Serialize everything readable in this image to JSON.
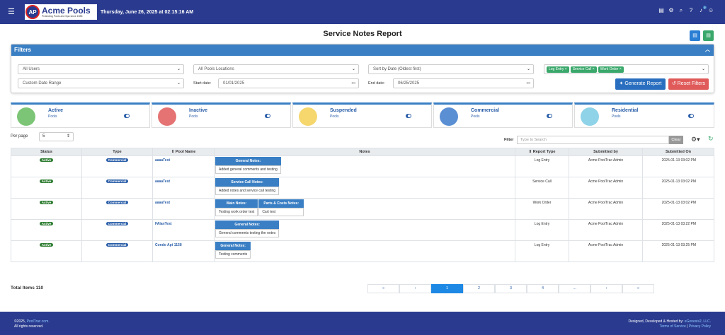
{
  "app": {
    "brand": "Acme Pools",
    "brand_mark": "AP",
    "tagline": "Protecting Pools and Spa since 1985",
    "datetime": "Thursday, June 26, 2025 at 02:15:16 AM",
    "notif_count": "2"
  },
  "page": {
    "title": "Service Notes Report"
  },
  "filters": {
    "title": "Filters",
    "users": "All Users",
    "locations": "All Pools Locations",
    "sort": "Sort by Date (Oldest first)",
    "date_range": "Custom Date Range",
    "start_label": "Start date:",
    "start": "01/01/2025",
    "end_label": "End date:",
    "end": "06/25/2025",
    "tags": [
      "Log Entry",
      "Service Call",
      "Work Order"
    ],
    "generate": "Generate Report",
    "reset": "Reset Filters"
  },
  "cards": [
    {
      "title": "Active",
      "sub": "Pools"
    },
    {
      "title": "Inactive",
      "sub": "Pools"
    },
    {
      "title": "Suspended",
      "sub": "Pools"
    },
    {
      "title": "Commercial",
      "sub": "Pools"
    },
    {
      "title": "Residential",
      "sub": "Pools"
    }
  ],
  "perpage": {
    "label": "Per page",
    "value": "5"
  },
  "filter": {
    "label": "Filter",
    "placeholder": "Type to Search",
    "clear": "Clear"
  },
  "table": {
    "headers": [
      "Status",
      "Type",
      "Pool Name",
      "Notes",
      "Report Type",
      "Submitted by",
      "Submitted On"
    ],
    "rows": [
      {
        "status": "Active",
        "type": "Commercial",
        "pool": "aaaaTest",
        "notes": [
          {
            "h": "General Notes:",
            "b": "Added general comments and testing"
          }
        ],
        "report": "Log Entry",
        "by": "Acme PoolTrac Admin",
        "on": "2025-01-13 03:02 PM"
      },
      {
        "status": "Active",
        "type": "Commercial",
        "pool": "aaaaTest",
        "notes": [
          {
            "h": "Service Call Notes:",
            "b": "Added notes and service call testing"
          }
        ],
        "report": "Service Call",
        "by": "Acme PoolTrac Admin",
        "on": "2025-01-13 03:02 PM"
      },
      {
        "status": "Active",
        "type": "Commercial",
        "pool": "aaaaTest",
        "notes": [
          {
            "h": "Main Notes:",
            "b": "Testing work order test"
          },
          {
            "h": "Parts & Costs Notes:",
            "b": "Cart test"
          }
        ],
        "report": "Work Order",
        "by": "Acme PoolTrac Admin",
        "on": "2025-01-13 03:02 PM"
      },
      {
        "status": "Active",
        "type": "Commercial",
        "pool": "FAlanTest",
        "notes": [
          {
            "h": "General Notes:",
            "b": "General comments testing the notes"
          }
        ],
        "report": "Log Entry",
        "by": "Acme PoolTrac Admin",
        "on": "2025-01-13 03:22 PM"
      },
      {
        "status": "Active",
        "type": "Commercial",
        "pool": "Condo Apt 1158",
        "notes": [
          {
            "h": "General Notes:",
            "b": "Testing comments"
          }
        ],
        "report": "Log Entry",
        "by": "Acme PoolTrac Admin",
        "on": "2025-01-13 03:25 PM"
      }
    ]
  },
  "total": {
    "label": "Total Items",
    "value": "110"
  },
  "pager": [
    "«",
    "‹",
    "1",
    "2",
    "3",
    "4",
    "...",
    "›",
    "»"
  ],
  "footer": {
    "copy": "©2025, ",
    "site": "PoolTrac.com.",
    "rights": "All rights reserved.",
    "designed": "Designed, Developed & Hosted by: ",
    "dev": "eGenesis2, LLC.",
    "terms": "Terms of Service",
    "sep": " | ",
    "privacy": "Privacy Policy"
  }
}
